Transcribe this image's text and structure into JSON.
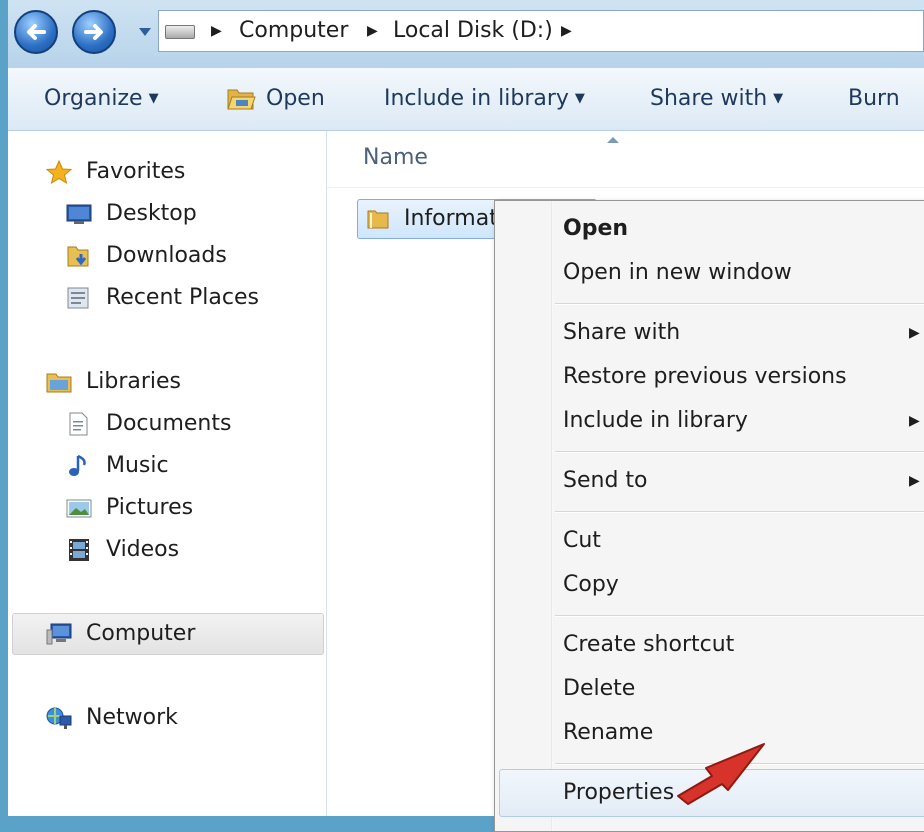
{
  "address": {
    "crumbs": [
      "Computer",
      "Local Disk (D:)"
    ]
  },
  "toolbar": {
    "organize": "Organize",
    "open": "Open",
    "include": "Include in library",
    "share": "Share with",
    "burn": "Burn"
  },
  "nav": {
    "favorites": "Favorites",
    "desktop": "Desktop",
    "downloads": "Downloads",
    "recent": "Recent Places",
    "libraries": "Libraries",
    "documents": "Documents",
    "music": "Music",
    "pictures": "Pictures",
    "videos": "Videos",
    "computer": "Computer",
    "network": "Network"
  },
  "content": {
    "column_name": "Name",
    "file_label": "Informat"
  },
  "context_menu": {
    "open": "Open",
    "open_new_window": "Open in new window",
    "share_with": "Share with",
    "restore": "Restore previous versions",
    "include": "Include in library",
    "send_to": "Send to",
    "cut": "Cut",
    "copy": "Copy",
    "create_shortcut": "Create shortcut",
    "delete": "Delete",
    "rename": "Rename",
    "properties": "Properties"
  },
  "colors": {
    "accent": "#2c6fc4",
    "annotation_arrow": "#d8332a"
  }
}
